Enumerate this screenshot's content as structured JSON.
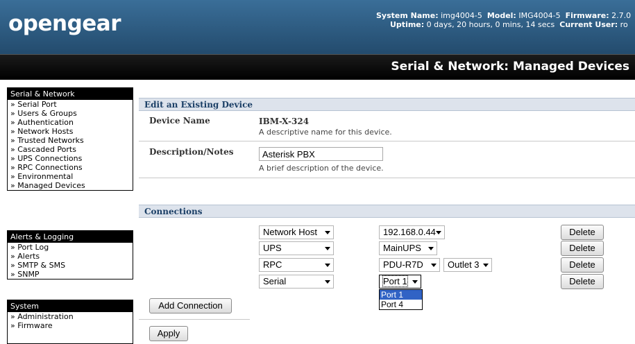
{
  "header": {
    "logo": "opengear",
    "system_name_label": "System Name:",
    "system_name": "img4004-5",
    "model_label": "Model:",
    "model": "IMG4004-5",
    "firmware_label": "Firmware:",
    "firmware": "2.7.0",
    "uptime_label": "Uptime:",
    "uptime": "0 days, 20 hours, 0 mins, 14 secs",
    "user_label": "Current User:",
    "user": "ro",
    "page_title": "Serial & Network: Managed Devices"
  },
  "sidebar": {
    "sections": [
      {
        "title": "Serial & Network",
        "items": [
          "Serial Port",
          "Users & Groups",
          "Authentication",
          "Network Hosts",
          "Trusted Networks",
          "Cascaded Ports",
          "UPS Connections",
          "RPC Connections",
          "Environmental",
          "Managed Devices"
        ]
      },
      {
        "title": "Alerts & Logging",
        "items": [
          "Port Log",
          "Alerts",
          "SMTP & SMS",
          "SNMP"
        ]
      },
      {
        "title": "System",
        "items": [
          "Administration",
          "Firmware"
        ]
      }
    ]
  },
  "edit": {
    "heading": "Edit an Existing Device",
    "device_name_label": "Device Name",
    "device_name_value": "IBM-X-324",
    "device_name_hint": "A descriptive name for this device.",
    "description_label": "Description/Notes",
    "description_value": "Asterisk PBX",
    "description_hint": "A brief description of the device."
  },
  "connections": {
    "heading": "Connections",
    "rows": [
      {
        "type": "Network Host",
        "target": "192.168.0.44",
        "outlet": "",
        "delete_label": "Delete"
      },
      {
        "type": "UPS",
        "target": "MainUPS",
        "outlet": "",
        "delete_label": "Delete"
      },
      {
        "type": "RPC",
        "target": "PDU-R7D",
        "outlet": "Outlet 3",
        "delete_label": "Delete"
      },
      {
        "type": "Serial",
        "target": "Port 1",
        "outlet": "",
        "delete_label": "Delete"
      }
    ],
    "dropdown_options": [
      "Port 1",
      "Port 4"
    ],
    "dropdown_selected": "Port 1",
    "add_label": "Add Connection",
    "apply_label": "Apply"
  }
}
